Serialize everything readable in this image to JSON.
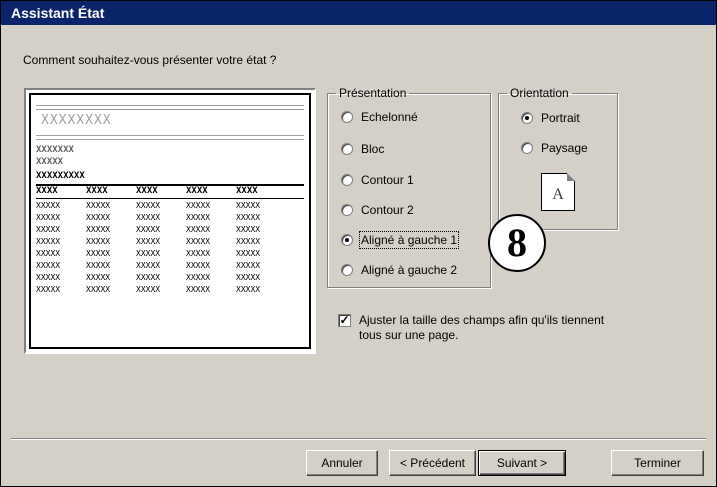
{
  "window": {
    "title": "Assistant État"
  },
  "question": "Comment souhaitez-vous présenter votre état ?",
  "preview": {
    "title_mark": "XXXXXXXX",
    "group_lines": [
      "XXXXXXX",
      "XXXXX",
      "XXXXXXXXX"
    ],
    "header_cells": [
      "XXXX",
      "XXXX",
      "XXXX",
      "XXXX",
      "XXXX"
    ],
    "row_cell": "XXXXX",
    "row_count": 8
  },
  "presentation": {
    "legend": "Présentation",
    "options": [
      {
        "label": "Echelonné",
        "selected": false
      },
      {
        "label": "Bloc",
        "selected": false
      },
      {
        "label": "Contour 1",
        "selected": false
      },
      {
        "label": "Contour 2",
        "selected": false
      },
      {
        "label": "Aligné à gauche 1",
        "selected": true
      },
      {
        "label": "Aligné à gauche 2",
        "selected": false
      }
    ]
  },
  "orientation": {
    "legend": "Orientation",
    "options": [
      {
        "label": "Portrait",
        "selected": true
      },
      {
        "label": "Paysage",
        "selected": false
      }
    ],
    "page_icon_letter": "A"
  },
  "badge": "8",
  "fit_checkbox": {
    "label": "Ajuster la taille des champs afin qu'ils tiennent tous sur une page.",
    "checked": true
  },
  "buttons": {
    "cancel": "Annuler",
    "previous": "< Précédent",
    "next": "Suivant >",
    "finish": "Terminer"
  }
}
